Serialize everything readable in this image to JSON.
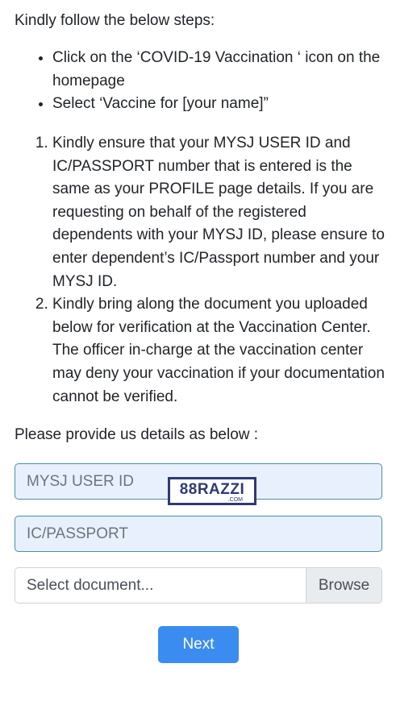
{
  "intro": "Kindly follow the below steps:",
  "steps": [
    "Click on the ‘COVID-19 Vaccination ‘ icon on the homepage",
    "Select ‘Vaccine for [your name]”"
  ],
  "notes": [
    "Kindly ensure that your MYSJ USER ID and IC/PASSPORT number that is entered is the same as your PROFILE page details. If you are requesting on behalf of the registered dependents with your MYSJ ID, please ensure to enter dependent’s IC/Passport number and your MYSJ ID.",
    "Kindly bring along the document you uploaded below for verification at the Vaccination Center. The officer in-charge at the vaccination center may deny your vaccination if your documentation cannot be verified."
  ],
  "form": {
    "lead": "Please provide us details as below :",
    "user_id_placeholder": "MYSJ USER ID",
    "passport_placeholder": "IC/PASSPORT",
    "document_label": "Select document...",
    "browse_label": "Browse",
    "next_label": "Next"
  },
  "watermark": {
    "text": "88RAZZI",
    "sub": ".COM"
  },
  "colors": {
    "primary_button": "#3b8cf0",
    "input_fill": "#e8f0fe",
    "input_border": "#4a90a4"
  }
}
